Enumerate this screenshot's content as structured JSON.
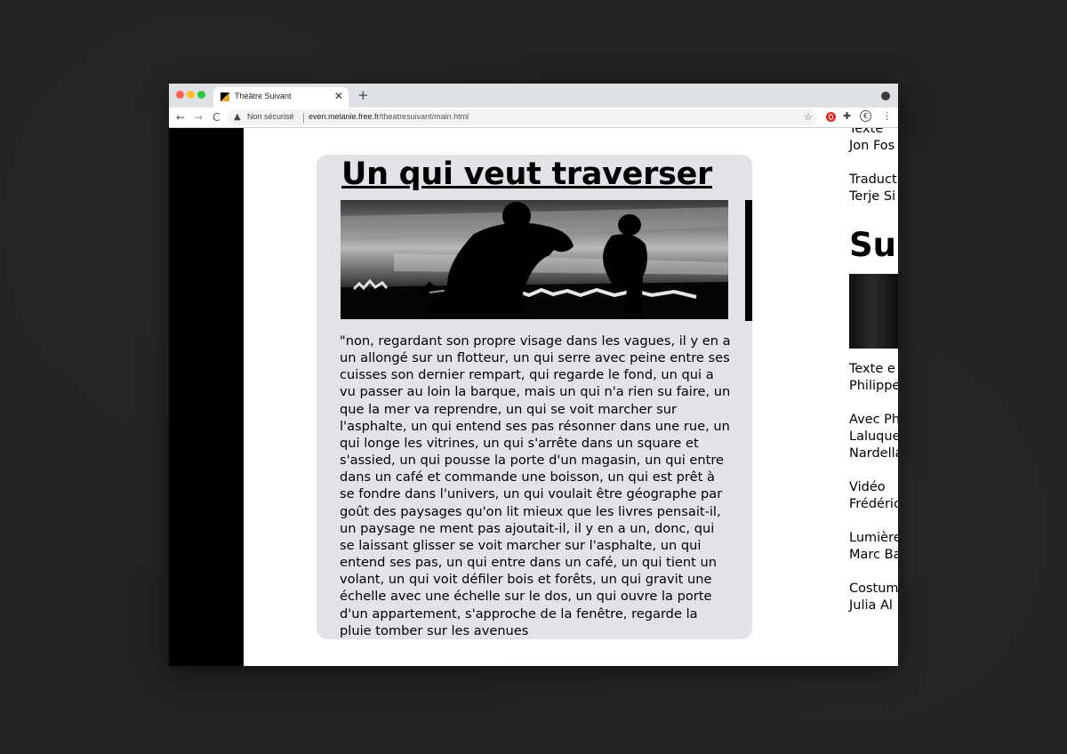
{
  "browser": {
    "tab_title": "Théâtre Suivant",
    "tab_close": "✕",
    "new_tab": "+",
    "back": "←",
    "forward": "→",
    "reload": "C",
    "security_icon": "▲",
    "security_label": "Non sécurisé",
    "url_domain": "even.melanie.free.fr",
    "url_path": "/theatresuivant/main.html",
    "star": "☆",
    "extension_puzzle": "✚",
    "extension_euro": "€",
    "menu": "⋮"
  },
  "article": {
    "title": "Un qui veut traverser",
    "body": "\"non, regardant son propre visage dans les vagues, il y en a un allongé sur un flotteur, un qui serre avec peine entre ses cuisses son dernier rempart, qui regarde le fond, un qui a vu passer au loin la barque, mais un qui n'a rien su faire, un que la mer va reprendre, un qui se voit marcher sur l'asphalte, un qui entend ses pas résonner dans une rue, un qui longe les vitrines, un qui s'arrête dans un square et s'assied, un qui pousse la porte d'un magasin, un qui entre dans un café et commande une boisson, un qui est prêt à se fondre dans l'univers, un qui voulait être géographe par goût des paysages qu'on lit mieux que les livres pensait-il, un paysage ne ment pas ajoutait-il, il y en a un, donc, qui se laissant glisser se voit marcher sur l'asphalte, un qui entend ses pas, un qui entre dans un café, un qui tient un volant, un qui voit défiler bois et forêts, un qui gravit une échelle avec une échelle sur le dos, un qui ouvre la porte d'un appartement, s'approche de la fenêtre, regarde la pluie tomber sur les avenues"
  },
  "credits_top": [
    {
      "role": "Texte",
      "names": [
        "Jon Fos"
      ]
    },
    {
      "role": "Traduct",
      "names": [
        "Terje Si"
      ]
    }
  ],
  "next": {
    "title": "Sui",
    "credits": [
      {
        "role": "Texte e",
        "names": [
          "Philippe"
        ]
      },
      {
        "role": "Avec Ph",
        "names": [
          "Laluque",
          "Nardella"
        ]
      },
      {
        "role": "Vidéo",
        "names": [
          "Frédéric"
        ]
      },
      {
        "role": "Lumière",
        "names": [
          "Marc Ba"
        ]
      },
      {
        "role": "Costum",
        "names": [
          "Julia Al"
        ]
      }
    ]
  }
}
